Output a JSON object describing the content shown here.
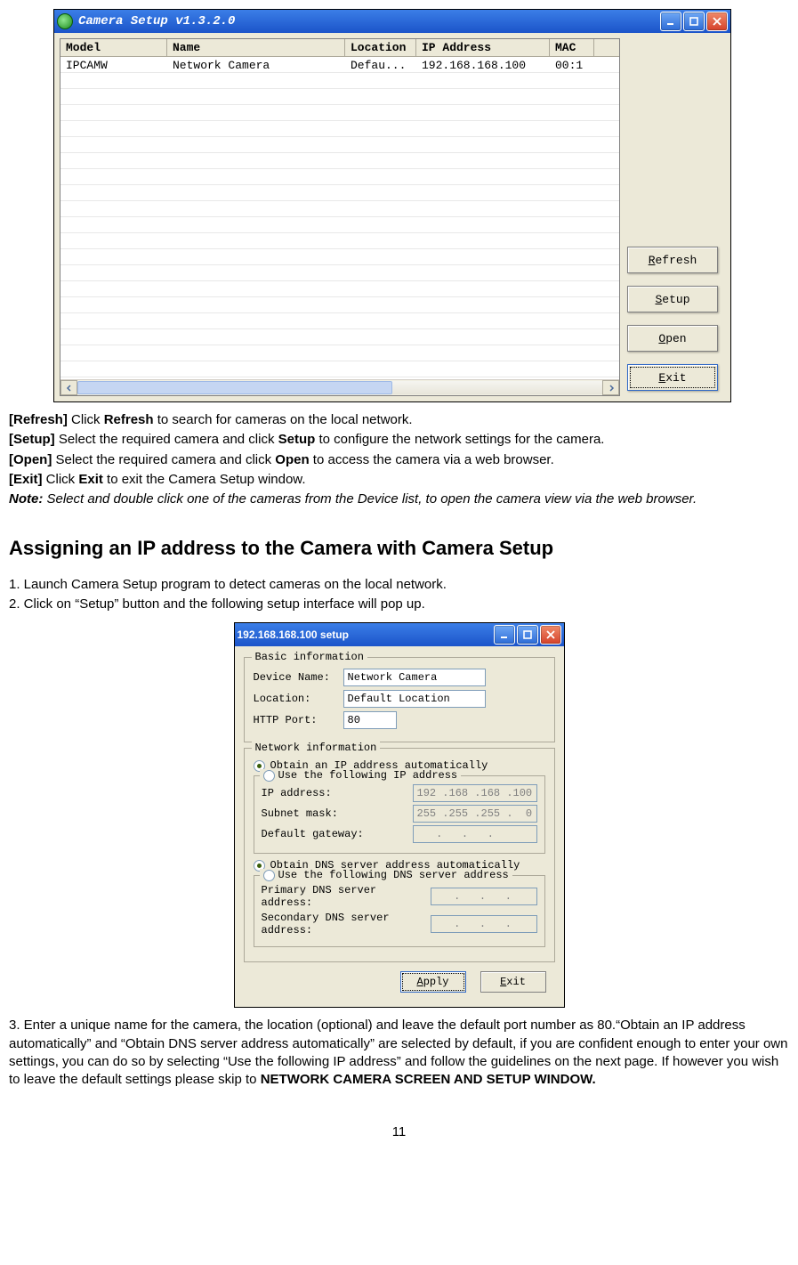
{
  "win1": {
    "title": "Camera Setup v1.3.2.0",
    "columns": [
      "Model",
      "Name",
      "Location",
      "IP Address",
      "MAC"
    ],
    "row": {
      "model": "IPCAMW",
      "name": "Network Camera",
      "location": "Defau...",
      "ip": "192.168.168.100",
      "mac": "00:1"
    },
    "buttons": {
      "refresh": "Refresh",
      "refresh_u": "R",
      "refresh_rest": "efresh",
      "setup": "Setup",
      "setup_u": "S",
      "setup_rest": "etup",
      "open": "Open",
      "open_u": "O",
      "open_rest": "pen",
      "exit": "Exit",
      "exit_u": "E",
      "exit_rest": "xit"
    }
  },
  "doc": {
    "refresh_label": "[Refresh]",
    "refresh_txt": " Click ",
    "refresh_bold": "Refresh",
    "refresh_txt2": " to search for cameras on the local network.",
    "setup_label": "[Setup]",
    "setup_txt": " Select the required camera and click ",
    "setup_bold": "Setup",
    "setup_txt2": " to configure the network settings for the camera.",
    "open_label": "[Open]",
    "open_txt": " Select the required camera and click ",
    "open_bold": "Open",
    "open_txt2": " to access the camera via a web browser.",
    "exit_label": "[Exit]",
    "exit_txt": " Click ",
    "exit_bold": "Exit",
    "exit_txt2": " to exit the Camera Setup window.",
    "note_label": "Note:",
    "note_txt": " Select and double click one of the cameras from the Device list, to open the camera view via the web browser.",
    "h2": "Assigning an IP address to the Camera with Camera Setup",
    "step1": "1. Launch Camera Setup program to detect cameras on the local network.",
    "step2": "2. Click on “Setup” button and the following setup interface will pop up.",
    "step3a": "3. Enter a unique name for the camera, the location (optional) and leave the default port number as 80.“Obtain an IP address automatically” and “Obtain DNS server address automatically” are selected by default, if you are confident enough to enter your own settings, you can do so by selecting “Use the following IP address” and follow the guidelines on the next page. If however you wish to leave the default settings please skip to ",
    "step3b": "NETWORK CAMERA SCREEN AND SETUP WINDOW.",
    "page": "11"
  },
  "win2": {
    "title": "192.168.168.100 setup",
    "basic_legend": "Basic information",
    "net_legend": "Network information",
    "device_name_lbl": "Device Name:",
    "device_name_val": "Network Camera",
    "location_lbl": "Location:",
    "location_val": "Default Location",
    "http_lbl": "HTTP Port:",
    "http_val": "80",
    "auto_ip": "Obtain an IP address automatically",
    "use_ip": "Use the following IP address",
    "ip_lbl": "IP address:",
    "ip_val": "192 .168 .168 .100",
    "mask_lbl": "Subnet mask:",
    "mask_val": "255 .255 .255 .  0",
    "gw_lbl": "Default gateway:",
    "gw_val": "   .   .   .   ",
    "auto_dns": "Obtain DNS server address automatically",
    "use_dns": "Use the following DNS server address",
    "pdns_lbl": "Primary DNS server address:",
    "pdns_val": "   .   .   .   ",
    "sdns_lbl": "Secondary DNS server address:",
    "sdns_val": "   .   .   .   ",
    "apply": "Apply",
    "apply_u": "A",
    "apply_rest": "pply",
    "exit": "Exit",
    "exit_u": "E",
    "exit_rest": "xit"
  }
}
